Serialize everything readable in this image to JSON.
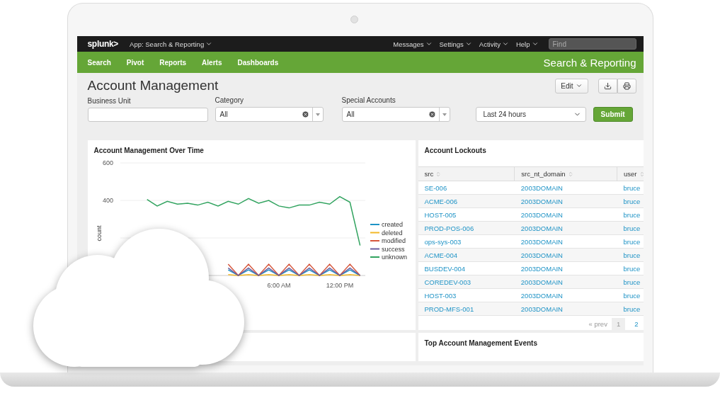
{
  "top_bar": {
    "logo": "splunk>",
    "app_menu": "App: Search & Reporting",
    "menus": [
      "Messages",
      "Settings",
      "Activity",
      "Help"
    ],
    "search": {
      "placeholder": "Find"
    }
  },
  "nav": {
    "items": [
      "Search",
      "Pivot",
      "Reports",
      "Alerts",
      "Dashboards"
    ],
    "app_title": "Search & Reporting"
  },
  "dashboard": {
    "title": "Account Management",
    "edit_button": "Edit"
  },
  "filters": [
    {
      "kind": "text",
      "label": "Business Unit"
    },
    {
      "kind": "select",
      "label": "Category",
      "value": "All"
    },
    {
      "kind": "select",
      "label": "Special Accounts",
      "value": "All"
    },
    {
      "kind": "time",
      "value": "Last 24 hours"
    }
  ],
  "submit": "Submit",
  "chart_panel": {
    "title": "Account Management Over Time",
    "chart_data": {
      "type": "line",
      "legend": "right",
      "ylabel": "count",
      "ylim": [
        0,
        600
      ],
      "yticks": [
        400,
        600
      ],
      "categories": [
        null,
        null,
        null,
        null,
        null,
        null,
        null,
        null,
        null,
        null,
        null,
        null,
        null,
        null,
        null,
        "6:00 AM",
        null,
        null,
        null,
        null,
        null,
        "12:00 PM",
        null,
        null
      ],
      "series": [
        {
          "name": "created",
          "color": "#1e93c6",
          "values": [
            null,
            null,
            null,
            null,
            null,
            null,
            null,
            null,
            null,
            null,
            30,
            0,
            30,
            0,
            30,
            0,
            30,
            0,
            30,
            0,
            30,
            0,
            30,
            0
          ]
        },
        {
          "name": "deleted",
          "color": "#f2b827",
          "values": [
            null,
            null,
            null,
            null,
            null,
            null,
            null,
            null,
            null,
            null,
            5,
            0,
            5,
            0,
            5,
            0,
            5,
            0,
            5,
            0,
            5,
            0,
            5,
            0
          ]
        },
        {
          "name": "modified",
          "color": "#d6563c",
          "values": [
            null,
            null,
            null,
            null,
            null,
            null,
            null,
            null,
            null,
            null,
            60,
            0,
            60,
            0,
            60,
            0,
            60,
            0,
            60,
            0,
            60,
            0,
            60,
            0
          ]
        },
        {
          "name": "success",
          "color": "#6a5c9e",
          "values": [
            null,
            null,
            null,
            null,
            null,
            null,
            null,
            null,
            null,
            null,
            40,
            0,
            40,
            0,
            40,
            0,
            40,
            0,
            40,
            0,
            40,
            0,
            40,
            0
          ]
        },
        {
          "name": "unknown",
          "color": "#31a35f",
          "values": [
            null,
            null,
            405,
            370,
            395,
            380,
            385,
            375,
            390,
            370,
            395,
            380,
            410,
            385,
            400,
            370,
            360,
            375,
            375,
            390,
            380,
            420,
            390,
            160
          ]
        }
      ]
    }
  },
  "lockouts_panel": {
    "title": "Account Lockouts",
    "table": {
      "columns": [
        "src",
        "src_nt_domain",
        "user"
      ],
      "rows": [
        [
          "SE-006",
          "2003DOMAIN",
          "bruce"
        ],
        [
          "ACME-006",
          "2003DOMAIN",
          "bruce"
        ],
        [
          "HOST-005",
          "2003DOMAIN",
          "bruce"
        ],
        [
          "PROD-POS-006",
          "2003DOMAIN",
          "bruce"
        ],
        [
          "ops-sys-003",
          "2003DOMAIN",
          "bruce"
        ],
        [
          "ACME-004",
          "2003DOMAIN",
          "bruce"
        ],
        [
          "BUSDEV-004",
          "2003DOMAIN",
          "bruce"
        ],
        [
          "COREDEV-003",
          "2003DOMAIN",
          "bruce"
        ],
        [
          "HOST-003",
          "2003DOMAIN",
          "bruce"
        ],
        [
          "PROD-MFS-001",
          "2003DOMAIN",
          "bruce"
        ]
      ]
    },
    "pagination": {
      "prev": "« prev",
      "pages": [
        {
          "label": "1",
          "selected": true
        },
        {
          "label": "2",
          "selected": false
        }
      ]
    }
  },
  "events_panel": {
    "title": "Top Account Management Events"
  }
}
